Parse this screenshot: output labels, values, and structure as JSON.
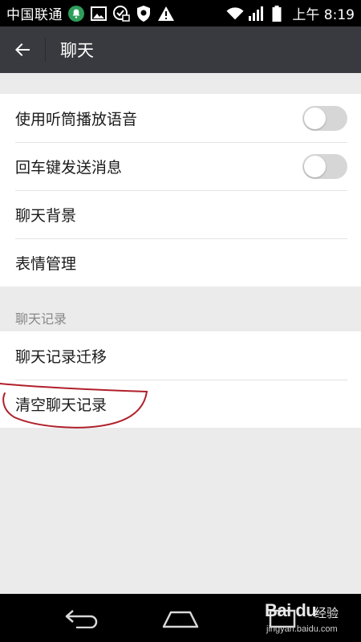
{
  "status_bar": {
    "carrier": "中国联通",
    "time": "上午 8:19",
    "left_icons": [
      "notification-bell-icon",
      "image-icon",
      "security-app-icon",
      "shield-icon",
      "warning-icon"
    ],
    "right_icons": [
      "wifi-icon",
      "signal-icon",
      "battery-icon"
    ]
  },
  "app_bar": {
    "title": "聊天",
    "back_icon": "arrow-left-icon"
  },
  "settings": {
    "group1": [
      {
        "label": "使用听筒播放语音",
        "toggle": "off"
      },
      {
        "label": "回车键发送消息",
        "toggle": "off"
      },
      {
        "label": "聊天背景"
      },
      {
        "label": "表情管理"
      }
    ],
    "section_header": "聊天记录",
    "group2": [
      {
        "label": "聊天记录迁移"
      },
      {
        "label": "清空聊天记录"
      }
    ]
  },
  "annotation": {
    "color": "#b0202a",
    "target": "清空聊天记录"
  },
  "nav_bar": {
    "buttons": [
      "back-nav-icon",
      "home-nav-icon",
      "recents-nav-icon"
    ]
  },
  "watermark": {
    "logo": "Bai du",
    "text": "经验",
    "url": "jingyan.baidu.com"
  },
  "colors": {
    "app_bar": "#393a3f",
    "background": "#ebebeb",
    "toggle_off": "#d6d6d6"
  }
}
